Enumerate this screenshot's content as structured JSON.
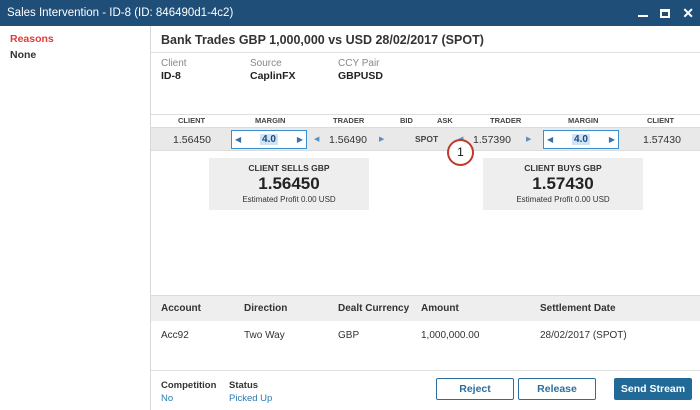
{
  "window": {
    "title": "Sales Intervention - ID-8 (ID: 846490d1-4c2)"
  },
  "sidebar": {
    "reasons_label": "Reasons",
    "reasons_value": "None"
  },
  "header": {
    "title": "Bank Trades GBP 1,000,000 vs USD 28/02/2017 (SPOT)"
  },
  "info": [
    {
      "label": "Client",
      "value": "ID-8"
    },
    {
      "label": "Source",
      "value": "CaplinFX"
    },
    {
      "label": "CCY Pair",
      "value": "GBPUSD"
    }
  ],
  "columns": [
    "CLIENT",
    "MARGIN",
    "TRADER",
    "BID",
    "ASK",
    "TRADER",
    "MARGIN",
    "CLIENT"
  ],
  "prices": {
    "bid_client": "1.56450",
    "bid_margin": "4.0",
    "bid_trader": "1.56490",
    "tenor": "SPOT",
    "ask_trader": "1.57390",
    "ask_margin": "4.0",
    "ask_client": "1.57430"
  },
  "cards": {
    "sell": {
      "title": "CLIENT SELLS GBP",
      "price": "1.56450",
      "profit": "Estimated Profit 0.00 USD"
    },
    "buy": {
      "title": "CLIENT BUYS GBP",
      "price": "1.57430",
      "profit": "Estimated Profit 0.00 USD"
    }
  },
  "callout": "1",
  "grid": {
    "headers": [
      "Account",
      "Direction",
      "Dealt Currency",
      "Amount",
      "Settlement Date"
    ],
    "rows": [
      [
        "Acc92",
        "Two Way",
        "GBP",
        "1,000,000.00",
        "28/02/2017 (SPOT)"
      ]
    ]
  },
  "footer": {
    "competition_label": "Competition",
    "competition_value": "No",
    "status_label": "Status",
    "status_value": "Picked Up",
    "reject": "Reject",
    "release": "Release",
    "send": "Send Stream"
  }
}
